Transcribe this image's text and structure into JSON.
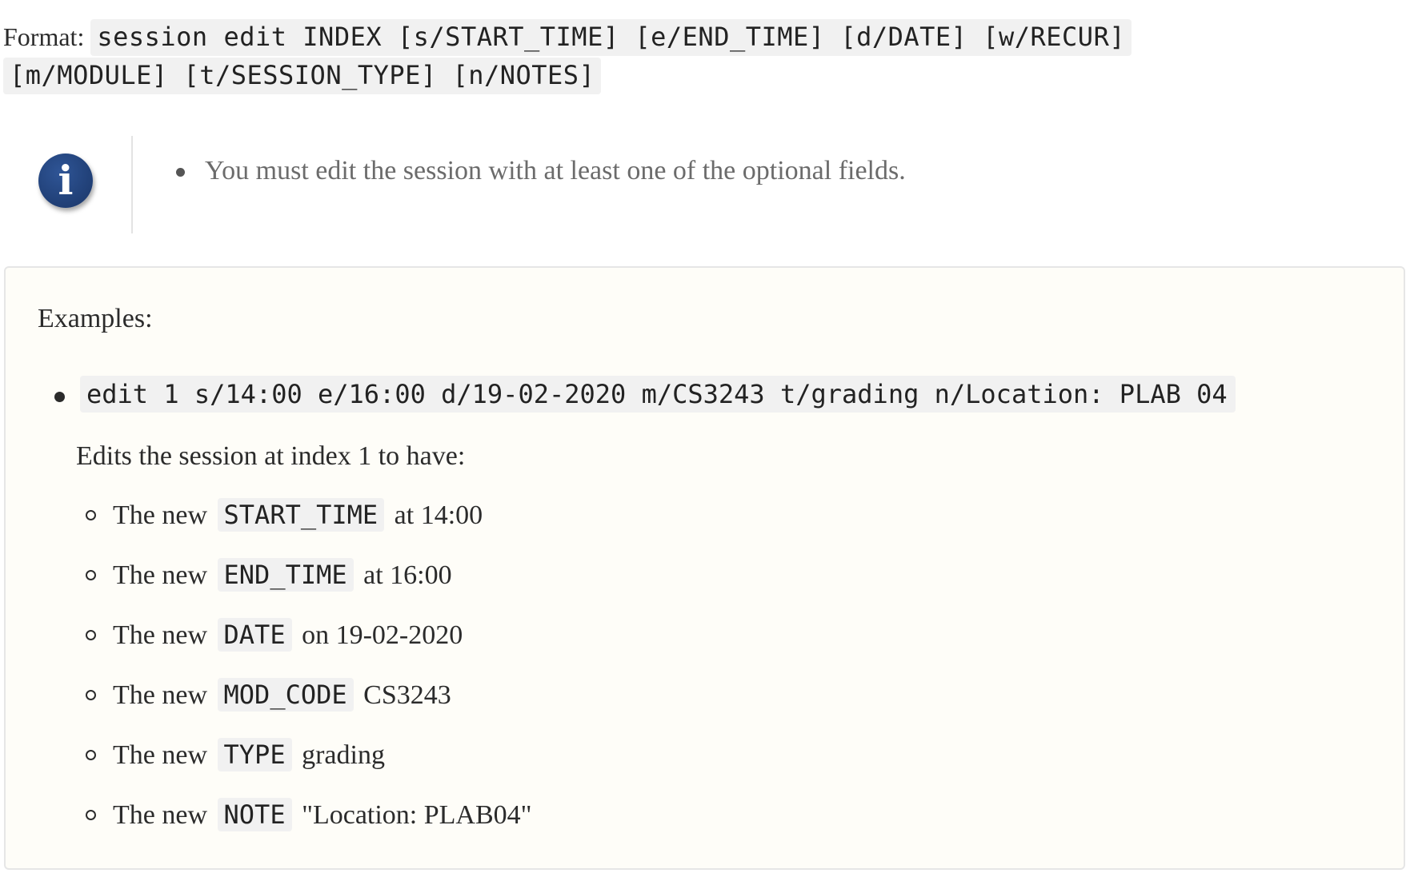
{
  "format": {
    "label": "Format:",
    "command": "session edit INDEX [s/START_TIME] [e/END_TIME] [d/DATE] [w/RECUR] [m/MODULE] [t/SESSION_TYPE] [n/NOTES]"
  },
  "info": {
    "icon": "info-icon",
    "icon_color": "#22427a",
    "bullets": [
      "You must edit the session with at least one of the optional fields."
    ]
  },
  "examples": {
    "title": "Examples:",
    "items": [
      {
        "command": "edit 1 s/14:00 e/16:00 d/19-02-2020 m/CS3243 t/grading n/Location: PLAB 04",
        "description": "Edits the session at index 1 to have:",
        "details": [
          {
            "prefix": "The new",
            "field": "START_TIME",
            "value": "at 14:00"
          },
          {
            "prefix": "The new",
            "field": "END_TIME",
            "value": "at 16:00"
          },
          {
            "prefix": "The new",
            "field": "DATE",
            "value": "on 19-02-2020"
          },
          {
            "prefix": "The new",
            "field": "MOD_CODE",
            "value": "CS3243"
          },
          {
            "prefix": "The new",
            "field": "TYPE",
            "value": "grading"
          },
          {
            "prefix": "The new",
            "field": "NOTE",
            "value": "\"Location: PLAB04\""
          }
        ]
      }
    ]
  }
}
